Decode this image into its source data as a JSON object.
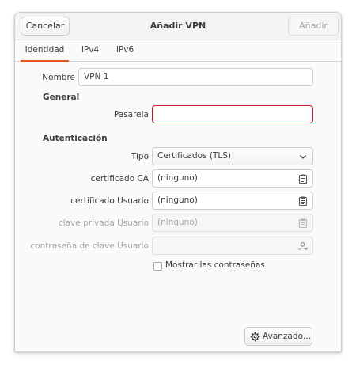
{
  "header": {
    "cancel_label": "Cancelar",
    "title": "Añadir VPN",
    "add_label": "Añadir"
  },
  "tabs": [
    {
      "label": "Identidad",
      "active": true
    },
    {
      "label": "IPv4",
      "active": false
    },
    {
      "label": "IPv6",
      "active": false
    }
  ],
  "form": {
    "name_label": "Nombre",
    "name_value": "VPN 1",
    "general_heading": "General",
    "gateway_label": "Pasarela",
    "gateway_value": "",
    "auth_heading": "Autenticación",
    "type_label": "Tipo",
    "type_value": "Certificados (TLS)",
    "ca_cert_label": "certificado CA",
    "ca_cert_value": "(ninguno)",
    "user_cert_label": "certificado Usuario",
    "user_cert_value": "(ninguno)",
    "private_key_label": "clave privada Usuario",
    "private_key_value": "(ninguno)",
    "key_password_label": "contraseña de clave Usuario",
    "key_password_value": "",
    "show_passwords_label": "Mostrar las contraseñas",
    "show_passwords_checked": false
  },
  "advanced_label": "Avanzado…",
  "icons": {
    "dropdown": "chevron-down-icon",
    "file_picker": "document-open-icon",
    "password_user": "user-icon",
    "advanced": "gear-icon"
  },
  "colors": {
    "accent": "#e95420",
    "error": "#c7162b"
  }
}
